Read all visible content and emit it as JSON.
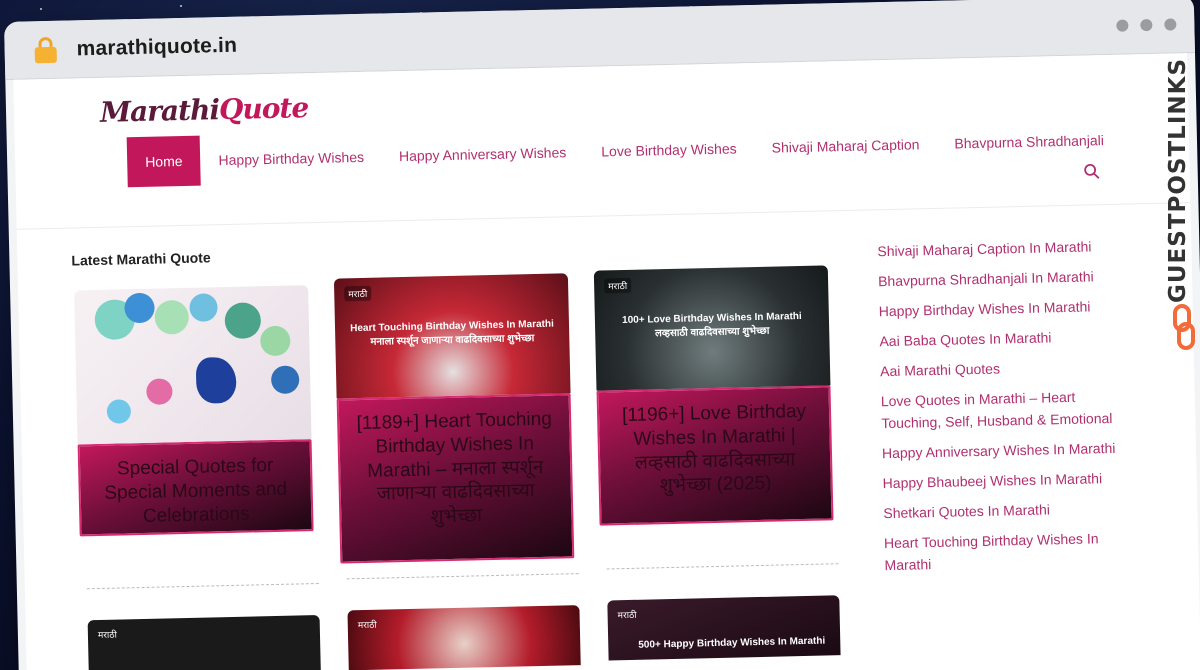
{
  "browser": {
    "url": "marathiquote.in"
  },
  "site": {
    "logo_part1": "Marathi",
    "logo_part2": "Quote",
    "nav": [
      {
        "label": "Home",
        "active": true
      },
      {
        "label": "Happy Birthday Wishes",
        "active": false
      },
      {
        "label": "Happy Anniversary Wishes",
        "active": false
      },
      {
        "label": "Love Birthday Wishes",
        "active": false
      },
      {
        "label": "Shivaji Maharaj Caption",
        "active": false
      },
      {
        "label": "Bhavpurna Shradhanjali",
        "active": false
      }
    ],
    "accent_color": "#c2185b"
  },
  "main": {
    "section_title": "Latest Marathi Quote",
    "cards": [
      {
        "caption": "Special Quotes for Special Moments and Celebrations",
        "thumb_badge": "",
        "thumb_text": ""
      },
      {
        "caption": "[1189+] Heart Touching Birthday Wishes In Marathi – मनाला स्पर्शून जाणाऱ्या वाढदिवसाच्या शुभेच्छा",
        "thumb_badge": "मराठी",
        "thumb_text": "Heart Touching Birthday Wishes In Marathi मनाला स्पर्शून जाणाऱ्या वाढदिवसाच्या शुभेच्छा"
      },
      {
        "caption": "[1196+] Love Birthday Wishes In Marathi | लव्हसाठी वाढदिवसाच्या शुभेच्छा (2025)",
        "thumb_badge": "मराठी",
        "thumb_text": "100+ Love Birthday Wishes In Marathi लव्हसाठी वाढदिवसाच्या शुभेच्छा"
      }
    ],
    "bottom_thumbs": [
      {
        "badge": "मराठी",
        "text": ""
      },
      {
        "badge": "मराठी",
        "text": ""
      },
      {
        "badge": "मराठी",
        "text": "500+ Happy Birthday Wishes In Marathi"
      }
    ]
  },
  "sidebar": {
    "links": [
      "Shivaji Maharaj Caption In Marathi",
      "Bhavpurna Shradhanjali In Marathi",
      "Happy Birthday Wishes In Marathi",
      "Aai Baba Quotes In Marathi",
      "Aai Marathi Quotes",
      "Love Quotes in Marathi – Heart Touching, Self, Husband & Emotional",
      "Happy Anniversary Wishes In Marathi",
      "Happy Bhaubeej Wishes In Marathi",
      "Shetkari Quotes In Marathi",
      "Heart Touching Birthday Wishes In Marathi"
    ]
  },
  "watermark": {
    "text": "GUESTPOSTLINKS"
  }
}
